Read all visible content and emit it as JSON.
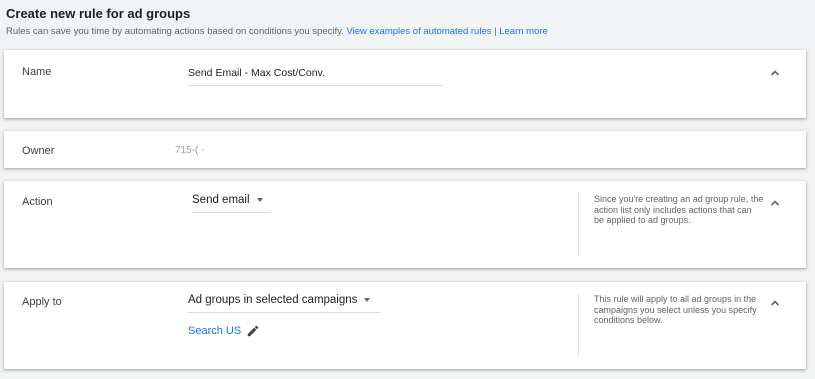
{
  "header": {
    "title": "Create new rule for ad groups",
    "subtitle": "Rules can save you time by automating actions based on conditions you specify.",
    "examples_link": "View examples of automated rules",
    "separator": "|",
    "learn_more_link": "Learn more"
  },
  "name_section": {
    "label": "Name",
    "value": "Send Email - Max Cost/Conv."
  },
  "owner_section": {
    "label": "Owner",
    "value": "715-(      -"
  },
  "action_section": {
    "label": "Action",
    "selected": "Send email",
    "note": "Since you're creating an ad group rule, the action list only includes actions that can be applied to ad groups."
  },
  "apply_section": {
    "label": "Apply to",
    "selected": "Ad groups in selected campaigns",
    "campaign": "Search US",
    "note": "This rule will apply to all ad groups in the campaigns you select unless you specify conditions below."
  },
  "icons": {
    "collapse": "chevron-up-icon",
    "dropdown": "caret-down-icon",
    "edit": "pencil-icon"
  },
  "colors": {
    "link": "#1a73e8",
    "text": "#3c4043",
    "muted": "#5f6368",
    "background": "#f1f3f4"
  }
}
